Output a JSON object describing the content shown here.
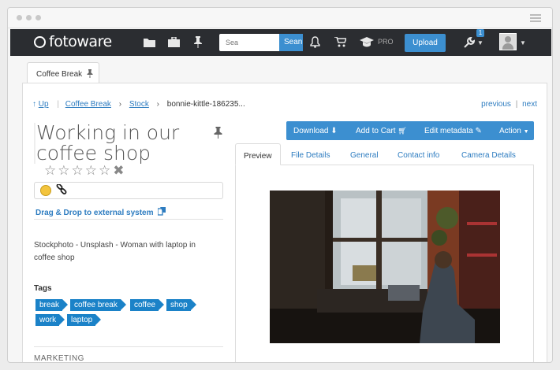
{
  "app": {
    "brand": "fotoware"
  },
  "navbar": {
    "search_placeholder": "Sea",
    "search_button": "Sean",
    "pro_label": "PRO",
    "upload_label": "Upload",
    "notification_count": "1"
  },
  "tab": {
    "label": "Coffee Break"
  },
  "breadcrumb": {
    "up": "Up",
    "items": [
      "Coffee Break",
      "Stock"
    ],
    "current": "bonnie-kittle-186235..."
  },
  "pager": {
    "previous": "previous",
    "separator": "|",
    "next": "next"
  },
  "asset": {
    "title": "Working in our coffee shop",
    "rating_stars": 0,
    "rating_max": 5,
    "dnd_label": "Drag & Drop to external system",
    "description": "Stockphoto - Unsplash - Woman with laptop in coffee shop",
    "tags_heading": "Tags",
    "tags": [
      "break",
      "coffee break",
      "coffee",
      "shop",
      "work",
      "laptop"
    ],
    "section_marketing": "MARKETING"
  },
  "actions": {
    "download": "Download",
    "add_to_cart": "Add to Cart",
    "edit_metadata": "Edit metadata",
    "action": "Action"
  },
  "detail_tabs": [
    "Preview",
    "File Details",
    "General",
    "Contact info",
    "Camera Details"
  ],
  "colors": {
    "accent": "#3c8fd0",
    "navbar": "#2b2d31",
    "tag": "#1b82c8"
  }
}
